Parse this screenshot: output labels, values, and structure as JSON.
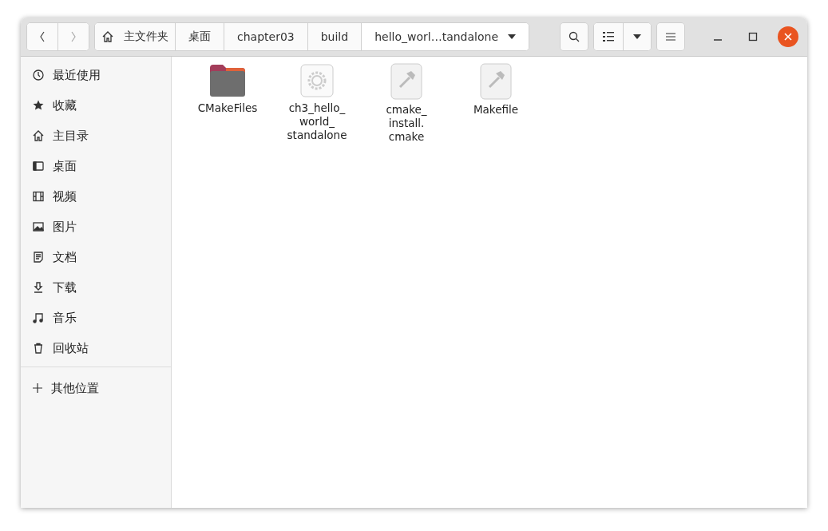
{
  "nav": {
    "back_disabled": false,
    "forward_disabled": true
  },
  "path": [
    {
      "label": "主文件夹",
      "home": true,
      "current": false
    },
    {
      "label": "桌面",
      "home": false,
      "current": false
    },
    {
      "label": "chapter03",
      "home": false,
      "current": false
    },
    {
      "label": "build",
      "home": false,
      "current": false
    },
    {
      "label": "hello_worl…tandalone",
      "home": false,
      "current": true
    }
  ],
  "sidebar": [
    {
      "label": "最近使用"
    },
    {
      "label": "收藏"
    },
    {
      "label": "主目录"
    },
    {
      "label": "桌面"
    },
    {
      "label": "视频"
    },
    {
      "label": "图片"
    },
    {
      "label": "文档"
    },
    {
      "label": "下载"
    },
    {
      "label": "音乐"
    },
    {
      "label": "回收站"
    }
  ],
  "other_places": {
    "label": "其他位置"
  },
  "files": [
    {
      "kind": "folder",
      "lines": [
        "CMakeFiles"
      ]
    },
    {
      "kind": "executable",
      "lines": [
        "ch3_hello_",
        "world_",
        "standalone"
      ]
    },
    {
      "kind": "script",
      "lines": [
        "cmake_",
        "install.",
        "cmake"
      ]
    },
    {
      "kind": "script",
      "lines": [
        "Makefile"
      ]
    }
  ]
}
